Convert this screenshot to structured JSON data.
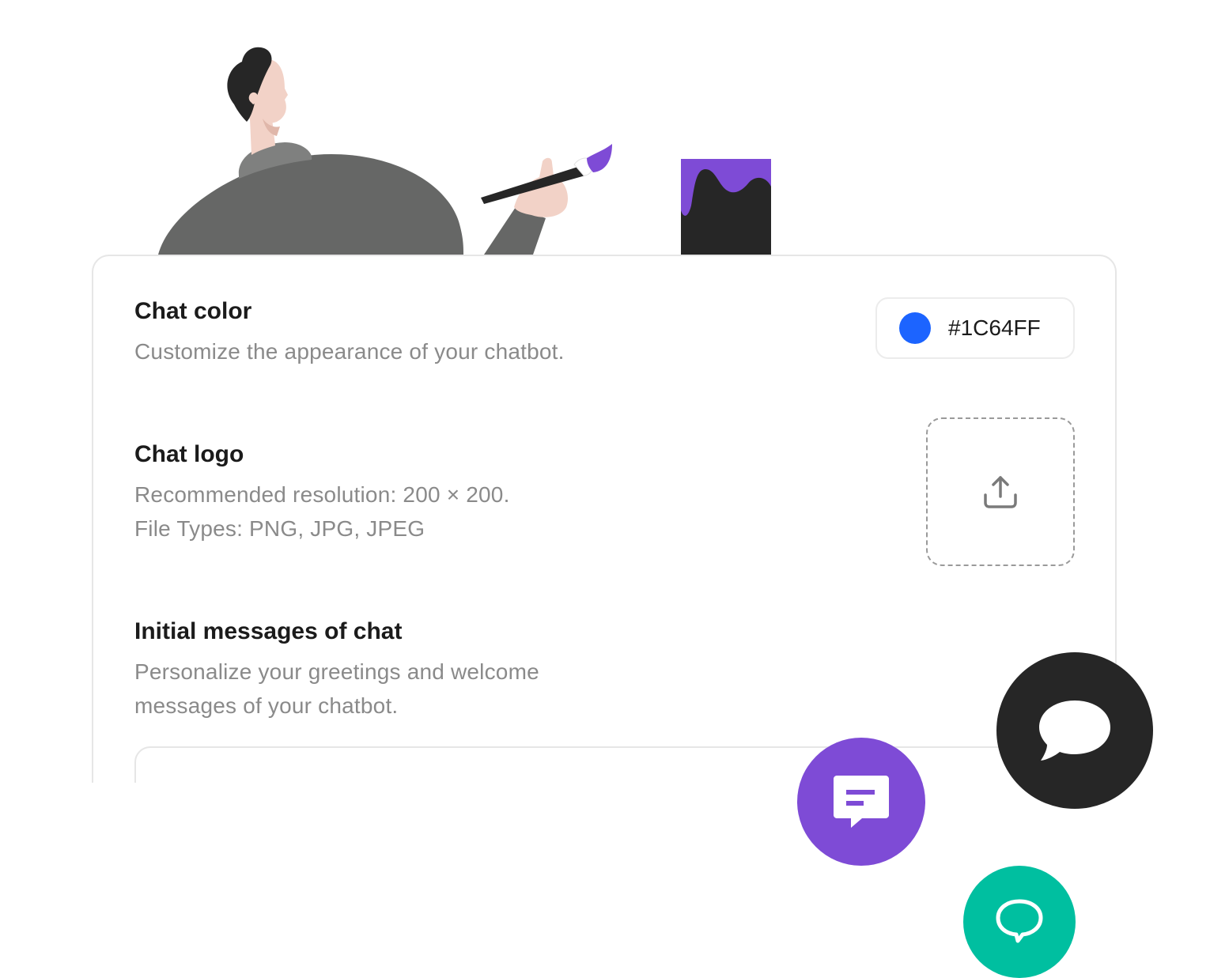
{
  "settings": {
    "chat_color": {
      "title": "Chat color",
      "description": "Customize the appearance of your chatbot.",
      "value": "#1C64FF"
    },
    "chat_logo": {
      "title": "Chat logo",
      "description_line1": "Recommended resolution: 200 × 200.",
      "description_line2": "File Types: PNG, JPG, JPEG",
      "upload_icon": "upload-icon"
    },
    "initial_messages": {
      "title": "Initial messages of chat",
      "description_line1": "Personalize your greetings and welcome",
      "description_line2": "messages of your chatbot."
    }
  },
  "chat_launchers": [
    {
      "icon": "message-lines-icon",
      "color": "#7E4BD6"
    },
    {
      "icon": "speech-bubble-icon",
      "color": "#262626"
    },
    {
      "icon": "chat-outline-icon",
      "color": "#00BFA0"
    }
  ],
  "illustration": {
    "subject": "person-painting-illustration",
    "colors": {
      "accent": "#7E4BD6",
      "sweater": "#666766",
      "skin": "#F2D2C7",
      "hair": "#262626"
    }
  }
}
